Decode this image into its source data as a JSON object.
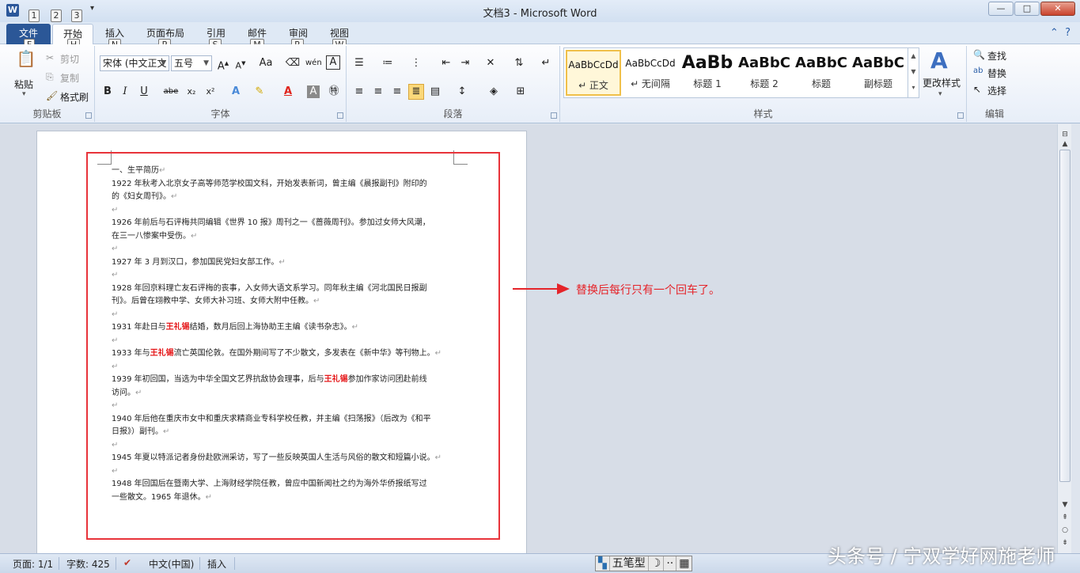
{
  "window": {
    "title": "文档3 - Microsoft Word",
    "qat_keytips": [
      "1",
      "2",
      "3"
    ],
    "controls": {
      "minimize": "—",
      "maximize": "□",
      "close": "✕"
    }
  },
  "tabs": [
    {
      "label": "文件",
      "keytip": "F"
    },
    {
      "label": "开始",
      "keytip": "H"
    },
    {
      "label": "插入",
      "keytip": "N"
    },
    {
      "label": "页面布局",
      "keytip": "P"
    },
    {
      "label": "引用",
      "keytip": "S"
    },
    {
      "label": "邮件",
      "keytip": "M"
    },
    {
      "label": "审阅",
      "keytip": "R"
    },
    {
      "label": "视图",
      "keytip": "W"
    }
  ],
  "ribbon": {
    "clipboard": {
      "label": "剪贴板",
      "paste": "粘贴",
      "cut": "剪切",
      "copy": "复制",
      "format_painter": "格式刷"
    },
    "font": {
      "label": "字体",
      "font_name": "宋体 (中文正文",
      "font_size": "五号"
    },
    "paragraph": {
      "label": "段落"
    },
    "styles": {
      "label": "样式",
      "change_styles": "更改样式",
      "items": [
        {
          "preview": "AaBbCcDd",
          "name": "↵ 正文"
        },
        {
          "preview": "AaBbCcDd",
          "name": "↵ 无间隔"
        },
        {
          "preview": "AaBb",
          "name": "标题 1"
        },
        {
          "preview": "AaBbC",
          "name": "标题 2"
        },
        {
          "preview": "AaBbC",
          "name": "标题"
        },
        {
          "preview": "AaBbC",
          "name": "副标题"
        }
      ]
    },
    "editing": {
      "label": "编辑",
      "find": "查找",
      "replace": "替换",
      "select": "选择"
    }
  },
  "document": {
    "lines": [
      {
        "a": "一、生平简历",
        "h": "",
        "b": "",
        "m": "↵"
      },
      {
        "a": "1922  年秋考入北京女子高等师范学校国文科，开始发表新词，曾主编《晨报副刊》附印的",
        "h": "",
        "b": "",
        "m": ""
      },
      {
        "a": "的《妇女周刊》。",
        "h": "",
        "b": "",
        "m": "↵"
      },
      {
        "a": "",
        "h": "",
        "b": "",
        "m": "↵"
      },
      {
        "a": "1926  年前后与石评梅共同编辑《世界 10 报》周刊之一《蔷薇周刊》。参加过女师大风潮，",
        "h": "",
        "b": "",
        "m": ""
      },
      {
        "a": "在三一八惨案中受伤。",
        "h": "",
        "b": "",
        "m": "↵"
      },
      {
        "a": "",
        "h": "",
        "b": "",
        "m": "↵"
      },
      {
        "a": "1927  年 3 月到汉口，参加国民党妇女部工作。",
        "h": "",
        "b": "",
        "m": "↵"
      },
      {
        "a": "",
        "h": "",
        "b": "",
        "m": "↵"
      },
      {
        "a": "1928  年回京料理亡友石评梅的丧事，入女师大语文系学习。同年秋主编《河北国民日报副",
        "h": "",
        "b": "",
        "m": ""
      },
      {
        "a": "刊》。后曾在翊教中学、女师大补习班、女师大附中任教。",
        "h": "",
        "b": "",
        "m": "↵"
      },
      {
        "a": "",
        "h": "",
        "b": "",
        "m": "↵"
      },
      {
        "a": "1931 年赴日与",
        "h": "王礼锡",
        "b": "结婚，数月后回上海协助王主编《读书杂志》。",
        "m": "↵"
      },
      {
        "a": "",
        "h": "",
        "b": "",
        "m": "↵"
      },
      {
        "a": "1933 年与",
        "h": "王礼锡",
        "b": "流亡英国伦敦。在国外期间写了不少散文，多发表在《新中华》等刊物上。",
        "m": "↵"
      },
      {
        "a": "",
        "h": "",
        "b": "",
        "m": "↵"
      },
      {
        "a": "1939  年初回国，当选为中华全国文艺界抗敌协会理事，后与",
        "h": "王礼锡",
        "b": "参加作家访问团赴前线",
        "m": ""
      },
      {
        "a": "访问。",
        "h": "",
        "b": "",
        "m": "↵"
      },
      {
        "a": "",
        "h": "",
        "b": "",
        "m": "↵"
      },
      {
        "a": "1940 年后他在重庆市女中和重庆求精商业专科学校任教，并主编《扫荡报》（后改为《和平",
        "h": "",
        "b": "",
        "m": ""
      },
      {
        "a": "日报》）副刊。",
        "h": "",
        "b": "",
        "m": "↵"
      },
      {
        "a": "",
        "h": "",
        "b": "",
        "m": "↵"
      },
      {
        "a": "1945 年夏以特派记者身份赴欧洲采访，写了一些反映英国人生活与风俗的散文和短篇小说。",
        "h": "",
        "b": "",
        "m": "↵"
      },
      {
        "a": "",
        "h": "",
        "b": "",
        "m": "↵"
      },
      {
        "a": "1948  年回国后在暨南大学、上海财经学院任教，曾应中国新闻社之约为海外华侨报纸写过",
        "h": "",
        "b": "",
        "m": ""
      },
      {
        "a": "一些散文。1965 年退休。",
        "h": "",
        "b": "",
        "m": "↵"
      }
    ]
  },
  "annotation": {
    "text": "替换后每行只有一个回车了。"
  },
  "statusbar": {
    "page": "页面: 1/1",
    "words": "字数: 425",
    "language": "中文(中国)",
    "mode": "插入",
    "ime": [
      "五笔型",
      "☽",
      "··",
      "▦"
    ]
  },
  "watermark": "头条号 / 宁双学好网施老师"
}
